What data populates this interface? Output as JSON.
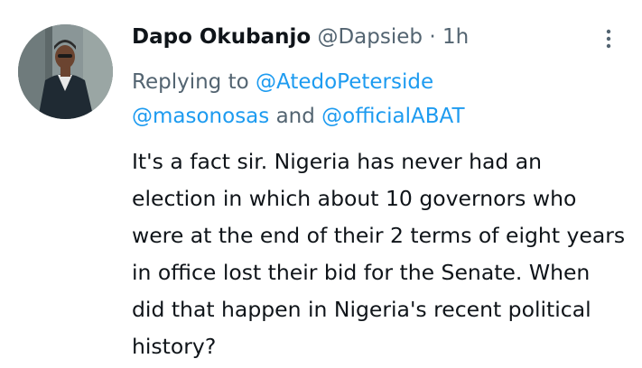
{
  "tweet": {
    "author": {
      "display_name": "Dapo Okubanjo",
      "handle": "@Dapsieb",
      "separator": "·",
      "timestamp": "1h"
    },
    "reply": {
      "prefix": "Replying to ",
      "mention_1": "@AtedoPeterside",
      "mention_2": "@masonosas",
      "conjunction": " and ",
      "mention_3": "@officialABAT"
    },
    "text": "It's a fact sir. Nigeria has never had an election in which about 10 governors who were at the end of their 2 terms of eight years in office lost their bid for the Senate. When did that happen in Nigeria's recent political history?",
    "more_icon": "vertical-ellipsis-icon"
  },
  "colors": {
    "text_primary": "#0f1419",
    "text_secondary": "#536471",
    "link": "#1d9bf0",
    "background": "#ffffff"
  }
}
